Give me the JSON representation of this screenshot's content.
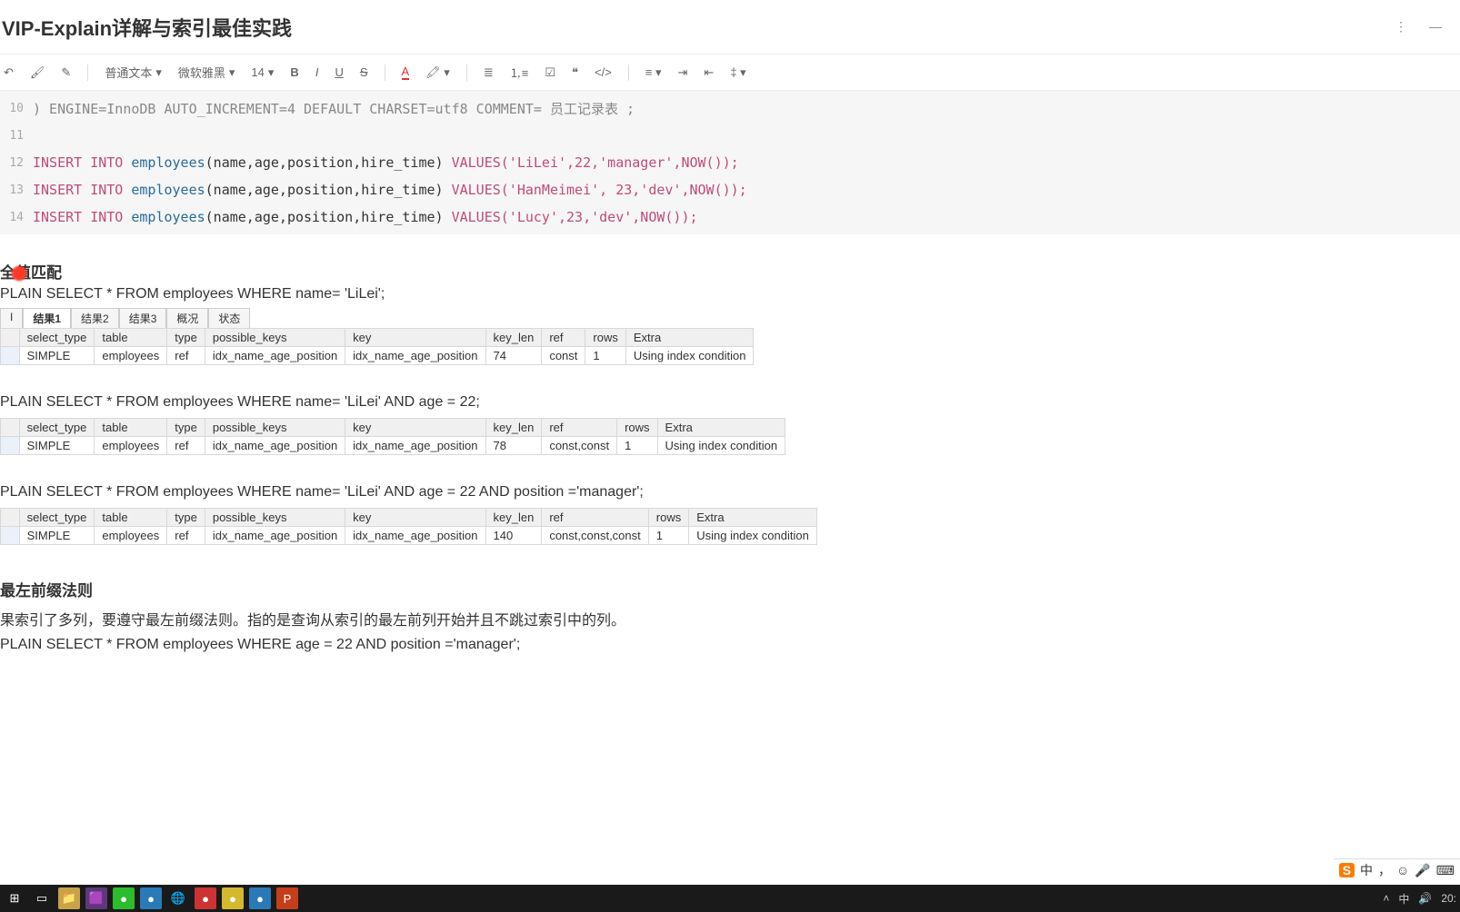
{
  "title": "VIP-Explain详解与索引最佳实践",
  "toolbar": {
    "style_label": "普通文本",
    "font_label": "微软雅黑",
    "size_label": "14"
  },
  "code": {
    "l10_no": "10",
    "l10": ") ENGINE=InnoDB AUTO_INCREMENT=4 DEFAULT CHARSET=utf8 COMMENT= 员工记录表 ;",
    "l11_no": "11",
    "l12_no": "12",
    "l13_no": "13",
    "l14_no": "14",
    "insert_kw": "INSERT INTO",
    "employees": "employees",
    "cols": "(name,age,position,hire_time)",
    "values_kw": "VALUES",
    "v12": "('LiLei',22,'manager',NOW());",
    "v13": "('HanMeimei', 23,'dev',NOW());",
    "v14": "('Lucy',23,'dev',NOW());"
  },
  "section1": {
    "heading": "全值匹配",
    "sql1": "PLAIN SELECT * FROM employees WHERE name= 'LiLei';",
    "sql2": "PLAIN SELECT * FROM employees WHERE name= 'LiLei' AND age = 22;",
    "sql3": "PLAIN SELECT * FROM employees WHERE name= 'LiLei' AND age = 22 AND position ='manager';"
  },
  "tabs": {
    "t0": "I",
    "t1": "结果1",
    "t2": "结果2",
    "t3": "结果3",
    "t4": "概况",
    "t5": "状态"
  },
  "cols": {
    "select_type": "select_type",
    "table": "table",
    "type": "type",
    "possible_keys": "possible_keys",
    "key": "key",
    "key_len": "key_len",
    "ref": "ref",
    "rows": "rows",
    "extra": "Extra"
  },
  "row1": {
    "select_type": "SIMPLE",
    "table": "employees",
    "type": "ref",
    "possible_keys": "idx_name_age_position",
    "key": "idx_name_age_position",
    "key_len": "74",
    "ref": "const",
    "rows": "1",
    "extra": "Using index condition"
  },
  "row2": {
    "select_type": "SIMPLE",
    "table": "employees",
    "type": "ref",
    "possible_keys": "idx_name_age_position",
    "key": "idx_name_age_position",
    "key_len": "78",
    "ref": "const,const",
    "rows": "1",
    "extra": "Using index condition"
  },
  "row3": {
    "select_type": "SIMPLE",
    "table": "employees",
    "type": "ref",
    "possible_keys": "idx_name_age_position",
    "key": "idx_name_age_position",
    "key_len": "140",
    "ref": "const,const,const",
    "rows": "1",
    "extra": "Using index condition"
  },
  "section2": {
    "heading": "最左前缀法则",
    "body": "果索引了多列，要遵守最左前缀法则。指的是查询从索引的最左前列开始并且不跳过索引中的列。",
    "sql": "PLAIN SELECT * FROM employees WHERE age = 22 AND position ='manager';"
  },
  "systray": {
    "ime": "中",
    "time": "20:"
  }
}
